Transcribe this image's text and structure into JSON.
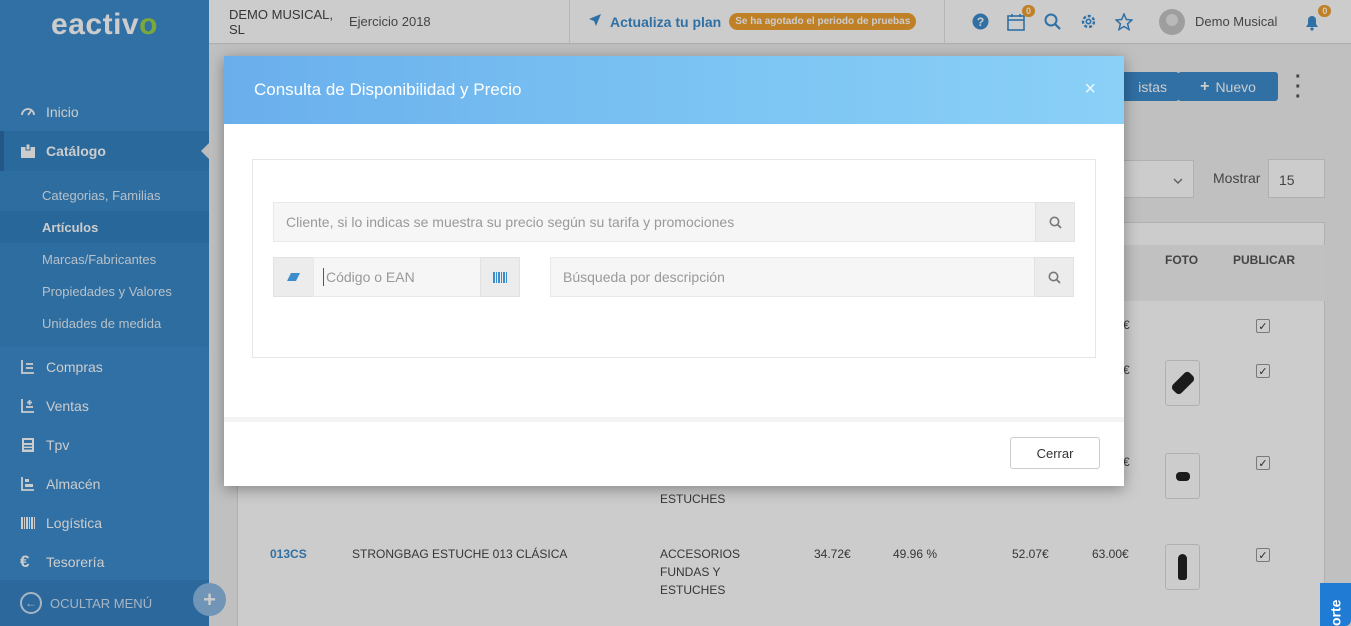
{
  "logo": {
    "pre": "eactiv",
    "accent": "o"
  },
  "sidebar": {
    "items": [
      {
        "label": "Inicio",
        "icon": "gauge-icon"
      },
      {
        "label": "Catálogo",
        "icon": "box-icon"
      },
      {
        "label": "Compras",
        "icon": "purchases-icon"
      },
      {
        "label": "Ventas",
        "icon": "sales-icon"
      },
      {
        "label": "Tpv",
        "icon": "pos-icon"
      },
      {
        "label": "Almacén",
        "icon": "warehouse-icon"
      },
      {
        "label": "Logística",
        "icon": "barcode-icon"
      },
      {
        "label": "Tesorería",
        "icon": "euro-icon"
      }
    ],
    "catalog_sub": [
      "Categorias, Familias",
      "Artículos",
      "Marcas/Fabricantes",
      "Propiedades y Valores",
      "Unidades de medida"
    ],
    "hide_menu": "OCULTAR MENÚ",
    "plus": "+"
  },
  "topbar": {
    "company": "DEMO MUSICAL, SL",
    "year": "Ejercicio 2018",
    "plan_label": "Actualiza tu plan",
    "trial_badge": "Se ha agotado el periodo de pruebas",
    "calendar_count": "0",
    "notifications_count": "0",
    "user_name": "Demo Musical"
  },
  "page": {
    "btn_listas": "istas",
    "btn_nuevo": "Nuevo",
    "mostrar_label": "Mostrar",
    "mostrar_value": "15",
    "columns": {
      "foto": "FOTO",
      "publicar": "PUBLICAR"
    },
    "rows": [
      {
        "price": "€"
      },
      {
        "price": "€"
      },
      {
        "price": "€",
        "category_tail": "ESTUCHES"
      },
      {
        "code": "013CS",
        "description": "STRONGBAG ESTUCHE 013 CLÁSICA",
        "category": [
          "ACCESORIOS",
          "FUNDAS Y",
          "ESTUCHES"
        ],
        "cost": "34.72€",
        "margin": "49.96 %",
        "price": "52.07€",
        "pvp": "63.00€"
      }
    ]
  },
  "modal": {
    "title": "Consulta de Disponibilidad y Precio",
    "close": "×",
    "client_placeholder": "Cliente, si lo indicas se muestra su precio según su tarifa y promociones",
    "code_placeholder": "Código o EAN",
    "desc_placeholder": "Búsqueda por descripción",
    "close_button": "Cerrar"
  },
  "soporte": "orte"
}
